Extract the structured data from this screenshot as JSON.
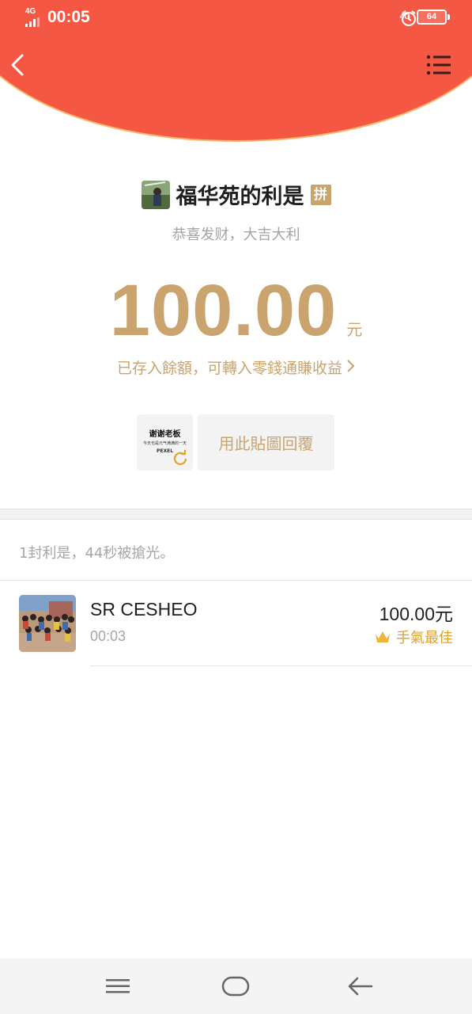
{
  "status_bar": {
    "network_left": "4G",
    "time": "00:05",
    "network_right": "4G",
    "battery": "64"
  },
  "header": {
    "back_icon": "chevron-left-icon",
    "menu_icon": "list-menu-icon",
    "color": "#f45743"
  },
  "packet": {
    "title": "福华苑的利是",
    "badge": "拼",
    "greeting": "恭喜发财，大吉大利",
    "amount": "100.00",
    "unit": "元",
    "deposit_link": "已存入餘額，可轉入零錢通賺收益",
    "accent_color": "#c9a46f"
  },
  "sticker": {
    "line1": "谢谢老板",
    "line2": "今天也是元气满满的一天",
    "line3": "PEXEL",
    "reply_label": "用此貼圖回覆"
  },
  "summary": "1封利是，44秒被搶光。",
  "receivers": [
    {
      "name": "SR CESHEO",
      "time": "00:03",
      "amount": "100.00元",
      "badge": "手氣最佳",
      "badge_icon": "crown-icon"
    }
  ],
  "nav": {
    "menu_icon": "menu-icon",
    "home_icon": "home-icon",
    "back_icon": "back-arrow-icon"
  }
}
